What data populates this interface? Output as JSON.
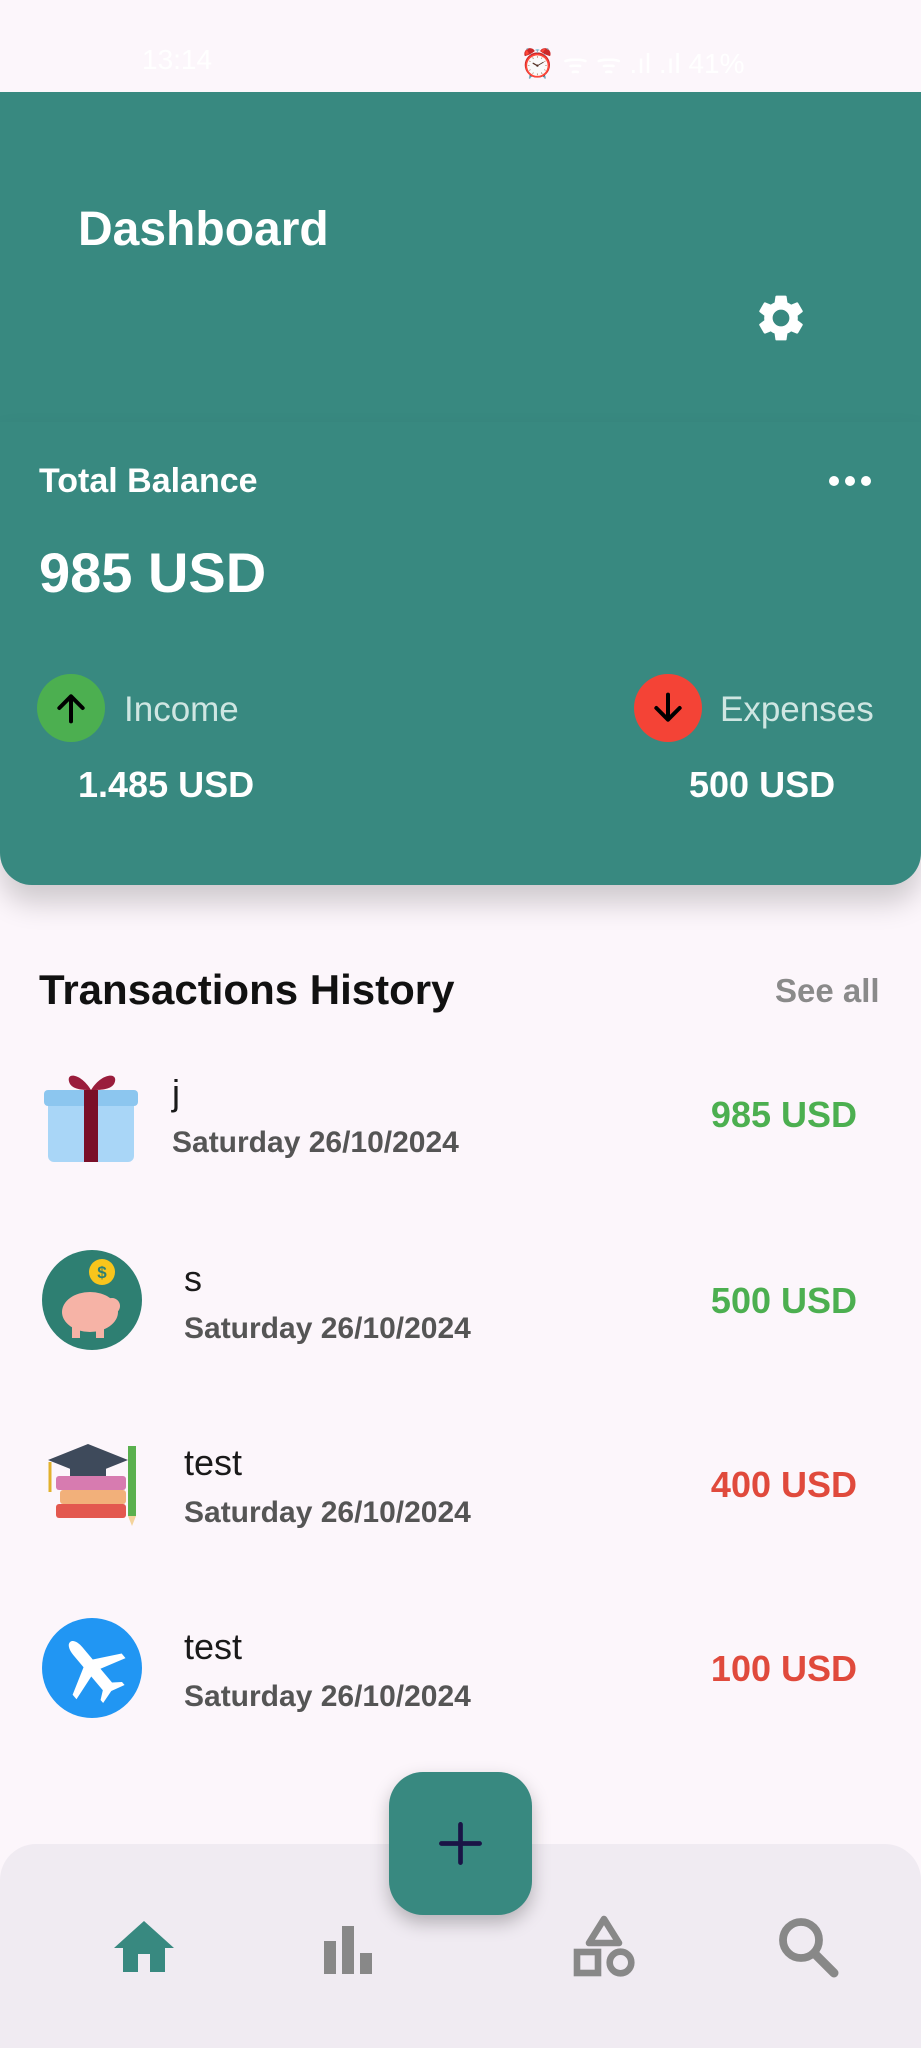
{
  "status_bar": {
    "time": "13:14",
    "icons": "⏰ ᯤ ᯤ .ıl .ıl 41%"
  },
  "header": {
    "title": "Dashboard",
    "settings_icon": "gear-icon"
  },
  "balance_card": {
    "label": "Total Balance",
    "amount": "985 USD",
    "income_label": "Income",
    "income_value": "1.485 USD",
    "expenses_label": "Expenses",
    "expenses_value": "500 USD"
  },
  "transactions": {
    "title": "Transactions History",
    "see_all": "See all",
    "items": [
      {
        "name": "j",
        "date": "Saturday  26/10/2024",
        "amount": "985 USD",
        "kind": "income",
        "icon": "gift-icon"
      },
      {
        "name": "s",
        "date": "Saturday  26/10/2024",
        "amount": "500 USD",
        "kind": "income",
        "icon": "piggy-bank-icon"
      },
      {
        "name": "test",
        "date": "Saturday  26/10/2024",
        "amount": "400 USD",
        "kind": "expense",
        "icon": "education-icon"
      },
      {
        "name": "test",
        "date": "Saturday  26/10/2024",
        "amount": "100 USD",
        "kind": "expense",
        "icon": "airplane-icon"
      }
    ]
  },
  "colors": {
    "primary": "#388980",
    "income": "#4caf50",
    "expense": "#e04a3c",
    "background": "#fcf6fb"
  },
  "bottom_nav": {
    "items": [
      "home-icon",
      "bar-chart-icon",
      "shapes-icon",
      "search-icon"
    ],
    "active": "home-icon",
    "fab_icon": "plus-icon"
  }
}
